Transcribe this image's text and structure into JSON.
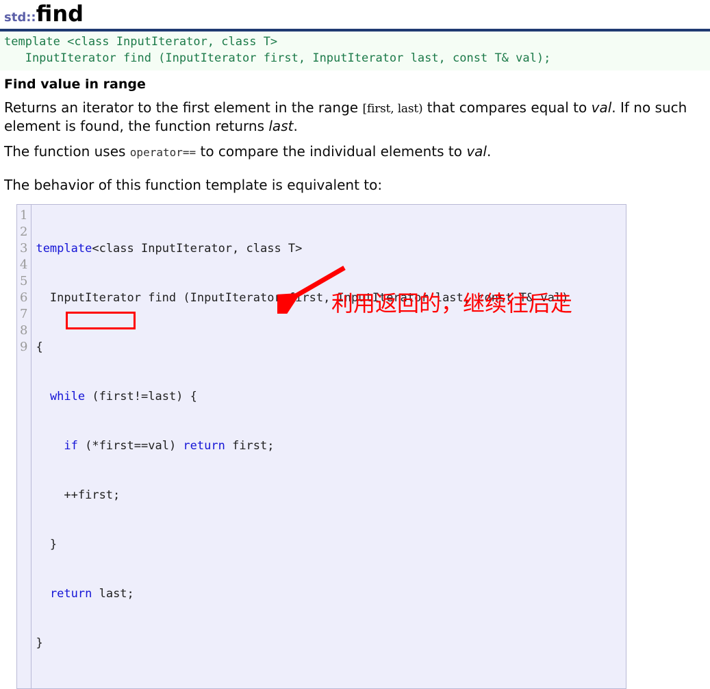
{
  "page": {
    "namespace": "std::",
    "name": "find",
    "rule_color": "#1f3a72"
  },
  "prototype": {
    "line1": "template <class InputIterator, class T>",
    "line2": "   InputIterator find (InputIterator first, InputIterator last, const T& val);",
    "text_color": "#1c7a49",
    "background": "#f5fdf5"
  },
  "description": {
    "heading": "Find value in range",
    "p1_a": "Returns an iterator to the first element in the range ",
    "p1_range": "[first, last)",
    "p1_b": " that compares equal to ",
    "p1_val": "val",
    "p1_c": ". If no such element is found, the function returns ",
    "p1_last": "last",
    "p1_d": ".",
    "p2_a": "The function uses ",
    "p2_code": "operator==",
    "p2_b": " to compare the individual elements to ",
    "p2_val": "val",
    "p2_c": ".",
    "p3": "The behavior of this function template is equivalent to:"
  },
  "code_block": {
    "background": "#eeeefb",
    "border_color": "#b9b9d6",
    "keyword_color": "#1414d6",
    "gutter_color": "#9a9a9a",
    "line_numbers": [
      "1",
      "2",
      "3",
      "4",
      "5",
      "6",
      "7",
      "8",
      "9"
    ],
    "lines": [
      "template<class InputIterator, class T>",
      "  InputIterator find (InputIterator first, InputIterator last, const T& val)",
      "{",
      "  while (first!=last) {",
      "    if (*first==val) return first;",
      "    ++first;",
      "  }",
      "  return last;",
      "}"
    ]
  },
  "annotations": {
    "note_text": "利用返回的，继续往后走",
    "note_color": "#ff0000",
    "highlight_target": "++first;",
    "arrow_color": "#ff0000"
  }
}
